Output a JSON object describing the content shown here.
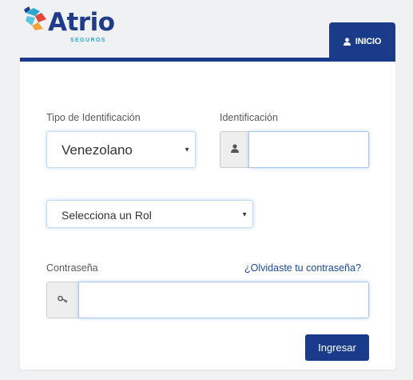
{
  "brand": {
    "name": "Atrio",
    "tagline": "SEGUROS",
    "primary_color": "#1a3a8a",
    "accent_color": "#2aa8cf"
  },
  "nav": {
    "tab_label": "INICIO",
    "tab_icon": "user-icon"
  },
  "form": {
    "id_type": {
      "label": "Tipo de Identificación",
      "selected": "Venezolano"
    },
    "id_number": {
      "label": "Identificación",
      "icon": "user-icon",
      "value": ""
    },
    "role": {
      "selected": "Selecciona un Rol"
    },
    "password": {
      "label": "Contraseña",
      "forgot_link": "¿Olvidaste tu contraseña?",
      "icon": "key-icon",
      "value": ""
    },
    "submit_label": "Ingresar"
  }
}
